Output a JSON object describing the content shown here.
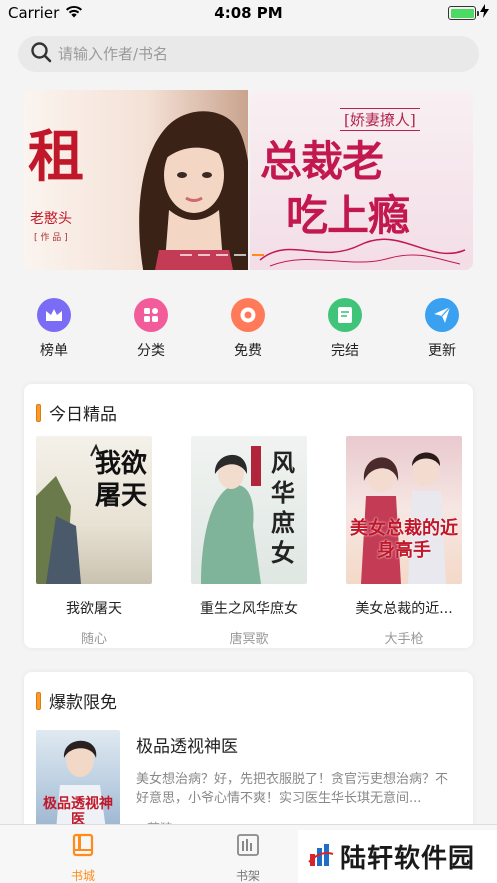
{
  "status_bar": {
    "carrier": "Carrier",
    "time": "4:08 PM",
    "battery_level": 1.0
  },
  "search": {
    "placeholder": "请输入作者/书名",
    "icon": "search-icon"
  },
  "banner": {
    "slides": [
      {
        "title": "租",
        "author": "老憨头",
        "works": "[ 作 品 ]"
      },
      {
        "tag": "[娇妻撩人]",
        "line1": "总裁老",
        "line2": "吃上瘾"
      }
    ],
    "active_index": 4
  },
  "categories": [
    {
      "label": "榜单",
      "icon": "crown-icon",
      "color": "#7b6cf6"
    },
    {
      "label": "分类",
      "icon": "grid-icon",
      "color": "#f25c9a"
    },
    {
      "label": "免费",
      "icon": "coin-icon",
      "color": "#ff7a59"
    },
    {
      "label": "完结",
      "icon": "document-icon",
      "color": "#3fc47a"
    },
    {
      "label": "更新",
      "icon": "send-icon",
      "color": "#3aa0f0"
    }
  ],
  "daily_picks": {
    "title": "今日精品",
    "books": [
      {
        "name": "我欲屠天",
        "author": "随心",
        "cover_text": "我欲屠天"
      },
      {
        "name": "重生之风华庶女",
        "author": "唐冥歌",
        "cover_text": "风华庶女"
      },
      {
        "name": "美女总裁的近...",
        "author": "大手枪",
        "cover_text": "美女总裁的近身高手"
      }
    ]
  },
  "hot_free": {
    "title": "爆款限免",
    "book": {
      "name": "极品透视神医",
      "desc": "美女想治病？好，先把衣服脱了！贪官污吏想治病？不好意思，小爷心情不爽！实习医生华长琪无意间...",
      "author": "苓狼",
      "cover_text": "极品透视神医"
    }
  },
  "tabbar": {
    "tabs": [
      {
        "label": "书城",
        "icon": "book-icon",
        "active": true
      },
      {
        "label": "书架",
        "icon": "bookshelf-icon",
        "active": false
      }
    ],
    "accent": "#ff8c1a"
  },
  "watermark": {
    "text": "陆轩软件园"
  }
}
